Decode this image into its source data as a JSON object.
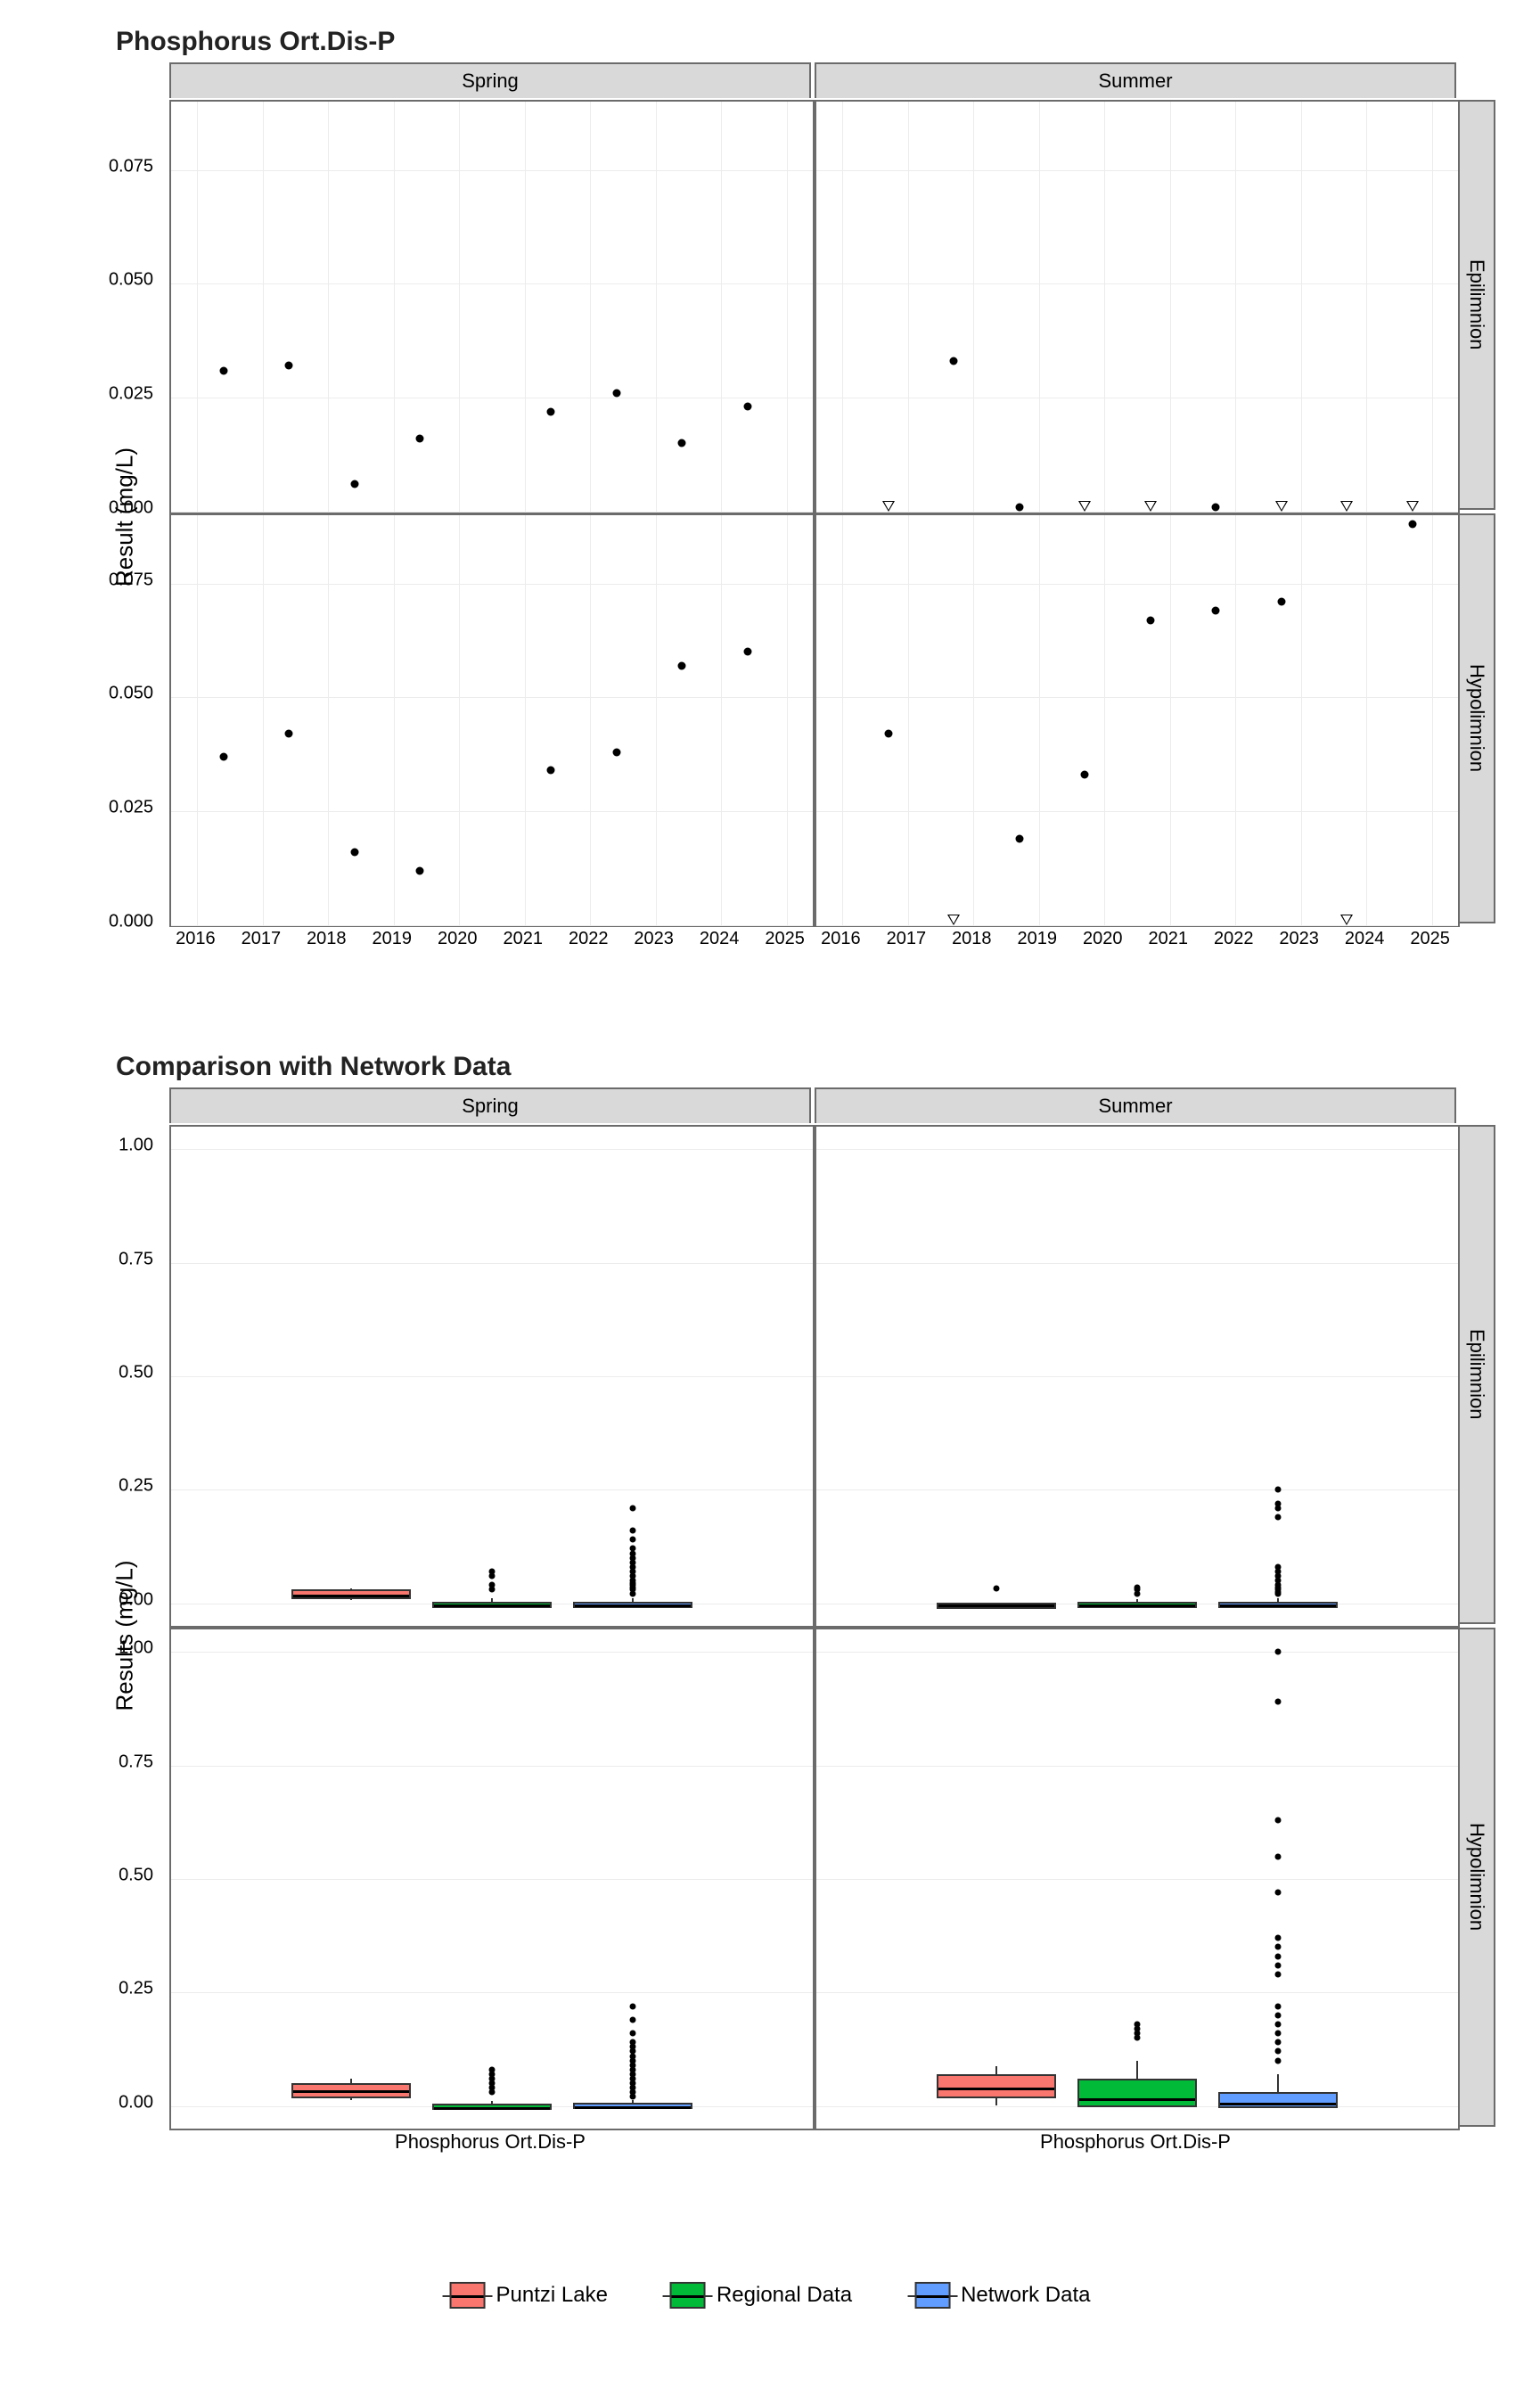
{
  "chart_data": [
    {
      "id": "timeseries",
      "title": "Phosphorus Ort.Dis-P",
      "ylabel": "Result (mg/L)",
      "ylim": [
        0,
        0.09
      ],
      "yticks": [
        0.0,
        0.025,
        0.05,
        0.075
      ],
      "xlim": [
        2015.6,
        2025.4
      ],
      "xticks": [
        2016,
        2017,
        2018,
        2019,
        2020,
        2021,
        2022,
        2023,
        2024,
        2025
      ],
      "col_facets": [
        "Spring",
        "Summer"
      ],
      "row_facets": [
        "Epilimnion",
        "Hypolimnion"
      ],
      "panels": {
        "Spring|Epilimnion": [
          {
            "x": 2016.4,
            "y": 0.031,
            "shape": "dot"
          },
          {
            "x": 2017.4,
            "y": 0.032,
            "shape": "dot"
          },
          {
            "x": 2018.4,
            "y": 0.006,
            "shape": "dot"
          },
          {
            "x": 2019.4,
            "y": 0.016,
            "shape": "dot"
          },
          {
            "x": 2021.4,
            "y": 0.022,
            "shape": "dot"
          },
          {
            "x": 2022.4,
            "y": 0.026,
            "shape": "dot"
          },
          {
            "x": 2023.4,
            "y": 0.015,
            "shape": "dot"
          },
          {
            "x": 2024.4,
            "y": 0.023,
            "shape": "dot"
          }
        ],
        "Summer|Epilimnion": [
          {
            "x": 2016.7,
            "y": 0.001,
            "shape": "tri"
          },
          {
            "x": 2017.7,
            "y": 0.033,
            "shape": "dot"
          },
          {
            "x": 2018.7,
            "y": 0.001,
            "shape": "dot"
          },
          {
            "x": 2019.7,
            "y": 0.001,
            "shape": "tri"
          },
          {
            "x": 2020.7,
            "y": 0.001,
            "shape": "tri"
          },
          {
            "x": 2021.7,
            "y": 0.001,
            "shape": "dot"
          },
          {
            "x": 2022.7,
            "y": 0.001,
            "shape": "tri"
          },
          {
            "x": 2023.7,
            "y": 0.001,
            "shape": "tri"
          },
          {
            "x": 2024.7,
            "y": 0.001,
            "shape": "tri"
          }
        ],
        "Spring|Hypolimnion": [
          {
            "x": 2016.4,
            "y": 0.037,
            "shape": "dot"
          },
          {
            "x": 2017.4,
            "y": 0.042,
            "shape": "dot"
          },
          {
            "x": 2018.4,
            "y": 0.016,
            "shape": "dot"
          },
          {
            "x": 2019.4,
            "y": 0.012,
            "shape": "dot"
          },
          {
            "x": 2021.4,
            "y": 0.034,
            "shape": "dot"
          },
          {
            "x": 2022.4,
            "y": 0.038,
            "shape": "dot"
          },
          {
            "x": 2023.4,
            "y": 0.057,
            "shape": "dot"
          },
          {
            "x": 2024.4,
            "y": 0.06,
            "shape": "dot"
          }
        ],
        "Summer|Hypolimnion": [
          {
            "x": 2016.7,
            "y": 0.042,
            "shape": "dot"
          },
          {
            "x": 2017.7,
            "y": 0.001,
            "shape": "tri"
          },
          {
            "x": 2018.7,
            "y": 0.019,
            "shape": "dot"
          },
          {
            "x": 2019.7,
            "y": 0.033,
            "shape": "dot"
          },
          {
            "x": 2020.7,
            "y": 0.067,
            "shape": "dot"
          },
          {
            "x": 2021.7,
            "y": 0.069,
            "shape": "dot"
          },
          {
            "x": 2022.7,
            "y": 0.071,
            "shape": "dot"
          },
          {
            "x": 2023.7,
            "y": 0.001,
            "shape": "tri"
          },
          {
            "x": 2024.7,
            "y": 0.088,
            "shape": "dot"
          }
        ]
      }
    },
    {
      "id": "boxplots",
      "title": "Comparison with Network Data",
      "ylabel": "Results (mg/L)",
      "ylim": [
        -0.05,
        1.05
      ],
      "yticks": [
        0.0,
        0.25,
        0.5,
        0.75,
        1.0
      ],
      "col_facets": [
        "Spring",
        "Summer"
      ],
      "row_facets": [
        "Epilimnion",
        "Hypolimnion"
      ],
      "x_category_label": "Phosphorus Ort.Dis-P",
      "groups": [
        "Puntzi Lake",
        "Regional Data",
        "Network Data"
      ],
      "group_colors": {
        "Puntzi Lake": "#f8766d",
        "Regional Data": "#00ba38",
        "Network Data": "#619cff"
      },
      "panels": {
        "Spring|Epilimnion": {
          "Puntzi Lake": {
            "low": 0.006,
            "q1": 0.016,
            "med": 0.022,
            "q3": 0.031,
            "high": 0.032,
            "out": []
          },
          "Regional Data": {
            "low": 0.0,
            "q1": 0.001,
            "med": 0.002,
            "q3": 0.004,
            "high": 0.01,
            "out": [
              0.03,
              0.04,
              0.06,
              0.07
            ]
          },
          "Network Data": {
            "low": 0.0,
            "q1": 0.001,
            "med": 0.002,
            "q3": 0.004,
            "high": 0.01,
            "out": [
              0.02,
              0.03,
              0.035,
              0.04,
              0.045,
              0.05,
              0.06,
              0.07,
              0.08,
              0.09,
              0.1,
              0.11,
              0.12,
              0.14,
              0.16,
              0.21
            ]
          }
        },
        "Summer|Epilimnion": {
          "Puntzi Lake": {
            "low": 0.001,
            "q1": 0.001,
            "med": 0.001,
            "q3": 0.001,
            "high": 0.001,
            "out": [
              0.033
            ]
          },
          "Regional Data": {
            "low": 0.0,
            "q1": 0.001,
            "med": 0.002,
            "q3": 0.004,
            "high": 0.009,
            "out": [
              0.02,
              0.03,
              0.035
            ]
          },
          "Network Data": {
            "low": 0.0,
            "q1": 0.001,
            "med": 0.002,
            "q3": 0.004,
            "high": 0.01,
            "out": [
              0.02,
              0.025,
              0.03,
              0.035,
              0.04,
              0.05,
              0.06,
              0.07,
              0.08,
              0.19,
              0.21,
              0.22,
              0.25
            ]
          }
        },
        "Spring|Hypolimnion": {
          "Puntzi Lake": {
            "low": 0.012,
            "q1": 0.025,
            "med": 0.038,
            "q3": 0.05,
            "high": 0.06,
            "out": []
          },
          "Regional Data": {
            "low": 0.0,
            "q1": 0.001,
            "med": 0.002,
            "q3": 0.005,
            "high": 0.011,
            "out": [
              0.03,
              0.04,
              0.05,
              0.06,
              0.07,
              0.08
            ]
          },
          "Network Data": {
            "low": 0.0,
            "q1": 0.001,
            "med": 0.003,
            "q3": 0.006,
            "high": 0.013,
            "out": [
              0.02,
              0.03,
              0.04,
              0.05,
              0.06,
              0.07,
              0.08,
              0.09,
              0.1,
              0.11,
              0.12,
              0.13,
              0.14,
              0.16,
              0.19,
              0.22
            ]
          }
        },
        "Summer|Hypolimnion": {
          "Puntzi Lake": {
            "low": 0.001,
            "q1": 0.025,
            "med": 0.045,
            "q3": 0.069,
            "high": 0.088,
            "out": []
          },
          "Regional Data": {
            "low": 0.0,
            "q1": 0.005,
            "med": 0.02,
            "q3": 0.06,
            "high": 0.1,
            "out": [
              0.15,
              0.16,
              0.17,
              0.18
            ]
          },
          "Network Data": {
            "low": 0.0,
            "q1": 0.003,
            "med": 0.01,
            "q3": 0.03,
            "high": 0.07,
            "out": [
              0.1,
              0.12,
              0.14,
              0.16,
              0.18,
              0.2,
              0.22,
              0.29,
              0.31,
              0.33,
              0.35,
              0.37,
              0.47,
              0.55,
              0.63,
              0.89,
              1.0
            ]
          }
        }
      }
    }
  ],
  "legend": {
    "items": [
      {
        "label": "Puntzi Lake",
        "color": "#f8766d"
      },
      {
        "label": "Regional Data",
        "color": "#00ba38"
      },
      {
        "label": "Network Data",
        "color": "#619cff"
      }
    ]
  }
}
